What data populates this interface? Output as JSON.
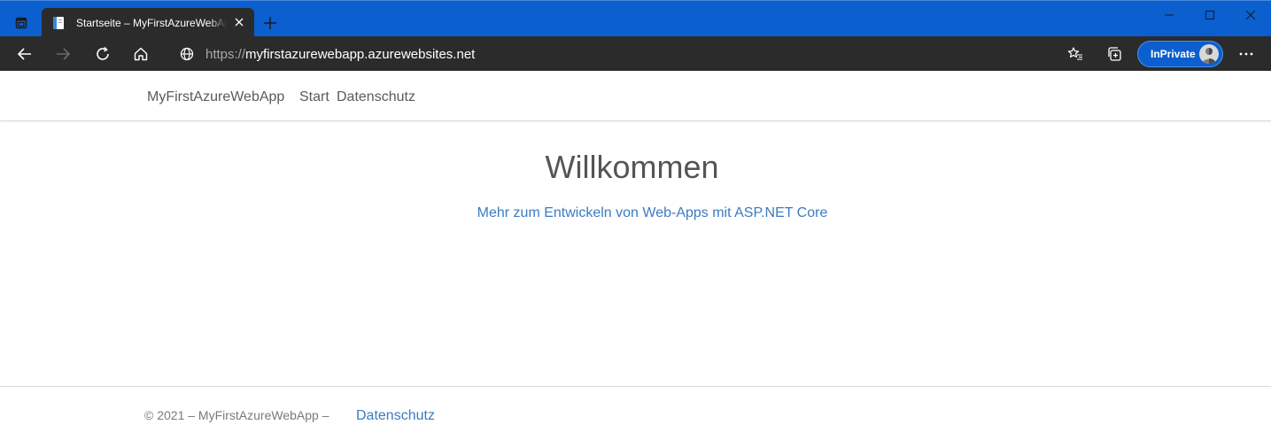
{
  "browser": {
    "tab": {
      "title": "Startseite – MyFirstAzureWebApp"
    },
    "address_bar": {
      "scheme": "https://",
      "host": "myfirstazurewebapp.azurewebsites.net"
    },
    "inprivate_label": "InPrivate",
    "colors": {
      "titlebar": "#0b5fcf",
      "toolbar": "#2b2b2b"
    },
    "icons": [
      "tab-actions-icon",
      "document-icon",
      "close-icon",
      "plus-icon",
      "minimize-icon",
      "maximize-icon",
      "back-arrow-icon",
      "forward-arrow-icon",
      "refresh-icon",
      "home-icon",
      "globe-icon",
      "favorites-star-icon",
      "collections-icon",
      "avatar",
      "more-dots-icon"
    ]
  },
  "site": {
    "navbar": {
      "brand": "MyFirstAzureWebApp",
      "links": [
        "Start",
        "Datenschutz"
      ]
    },
    "main": {
      "heading": "Willkommen",
      "link_text": "Mehr zum Entwickeln von Web-Apps mit ASP.NET Core"
    },
    "footer": {
      "copyright": "©  2021 –   MyFirstAzureWebApp –",
      "privacy_link": "Datenschutz"
    },
    "colors": {
      "link": "#3c7bc0",
      "text": "#555555"
    }
  }
}
